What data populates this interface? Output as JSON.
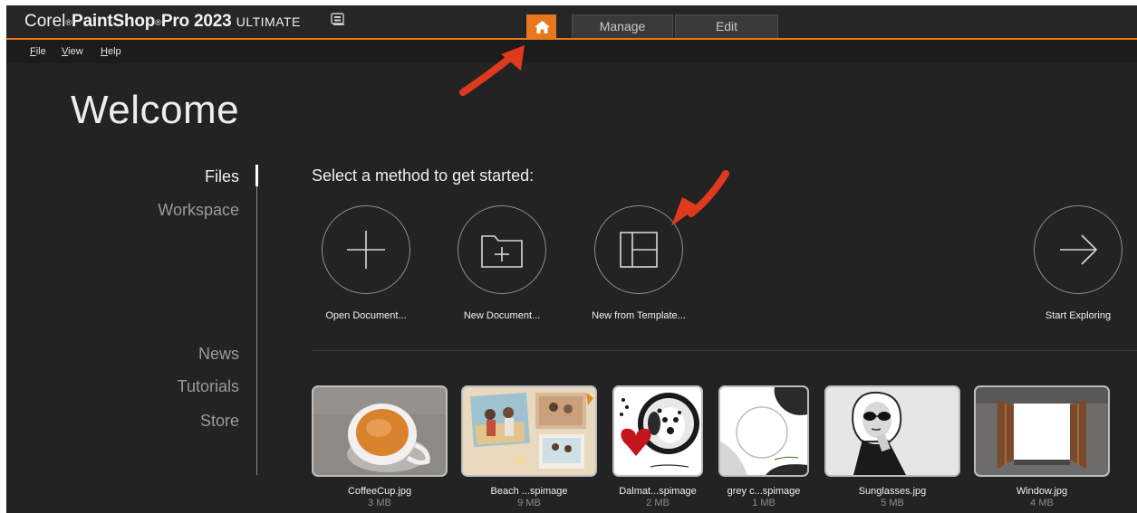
{
  "titlebar": {
    "brand": "Corel",
    "reg_mark": "®",
    "product": "PaintShop",
    "reg_mark_2": "®",
    "product_2": "Pro 2023",
    "edition": "ULTIMATE",
    "icon": "app-badge-icon"
  },
  "tabs": [
    {
      "label": "",
      "icon": "home-icon",
      "active": true
    },
    {
      "label": "Manage",
      "active": false
    },
    {
      "label": "Edit",
      "active": false
    }
  ],
  "menubar": {
    "items": [
      {
        "accel": "F",
        "rest": "ile"
      },
      {
        "accel": "V",
        "rest": "iew"
      },
      {
        "accel": "H",
        "rest": "elp"
      }
    ]
  },
  "welcome": {
    "heading": "Welcome",
    "nav": [
      "Files",
      "Workspace",
      "News",
      "Tutorials",
      "Store"
    ],
    "active_nav": "Files",
    "prompt": "Select a method to get started:"
  },
  "actions": [
    {
      "label": "Open Document...",
      "icon": "plus-icon"
    },
    {
      "label": "New Document...",
      "icon": "folder-plus-icon"
    },
    {
      "label": "New from Template...",
      "icon": "template-layout-icon"
    },
    {
      "label": "Start Exploring",
      "icon": "arrow-right-icon"
    }
  ],
  "recent_files": [
    {
      "name": "CoffeeCup.jpg",
      "size": "3 MB"
    },
    {
      "name": "Beach ...spimage",
      "size": "9 MB"
    },
    {
      "name": "Dalmat...spimage",
      "size": "2 MB"
    },
    {
      "name": "grey c...spimage",
      "size": "1 MB"
    },
    {
      "name": "Sunglasses.jpg",
      "size": "5 MB"
    },
    {
      "name": "Window.jpg",
      "size": "4 MB"
    }
  ],
  "colors": {
    "accent": "#e8781e",
    "background": "#232323",
    "annotation_arrow": "#e03a1e"
  }
}
